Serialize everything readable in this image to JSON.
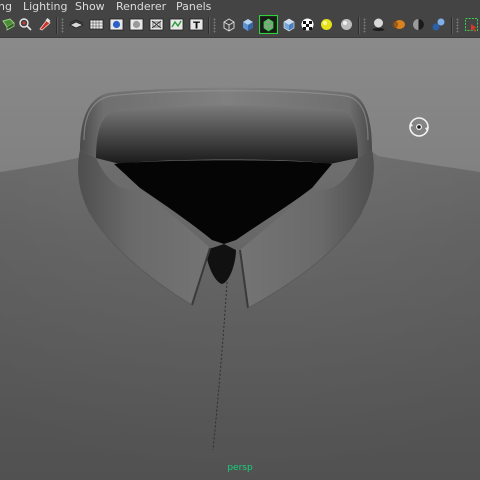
{
  "menubar": {
    "items": [
      {
        "label": "ng"
      },
      {
        "label": "Lighting"
      },
      {
        "label": "Show"
      },
      {
        "label": "Renderer"
      },
      {
        "label": "Panels"
      }
    ]
  },
  "toolbar": {
    "tools": [
      {
        "name": "select-camera-icon"
      },
      {
        "name": "camera-attributes-icon"
      },
      {
        "name": "bookmark-icon"
      },
      {
        "name": "image-plane-icon"
      },
      {
        "name": "grid-icon"
      },
      {
        "name": "film-gate-icon"
      },
      {
        "name": "resolution-gate-icon"
      },
      {
        "name": "gate-mask-icon"
      },
      {
        "name": "field-chart-icon"
      },
      {
        "name": "safe-action-icon"
      },
      {
        "name": "safe-title-icon"
      },
      {
        "name": "wireframe-icon"
      },
      {
        "name": "smooth-shade-icon"
      },
      {
        "name": "wireframe-on-shaded-icon"
      },
      {
        "name": "xray-icon"
      },
      {
        "name": "textured-icon"
      },
      {
        "name": "use-all-lights-icon"
      },
      {
        "name": "shadows-icon"
      },
      {
        "name": "ambient-occlusion-icon"
      },
      {
        "name": "motion-blur-icon"
      },
      {
        "name": "anti-aliasing-icon"
      },
      {
        "name": "depth-of-field-icon"
      },
      {
        "name": "isolate-select-icon"
      }
    ]
  },
  "viewport": {
    "camera_label": "persp",
    "tumble_icon": "tumble-icon",
    "background_color": "#7e7e7e",
    "camera_label_color": "#12d47a"
  }
}
